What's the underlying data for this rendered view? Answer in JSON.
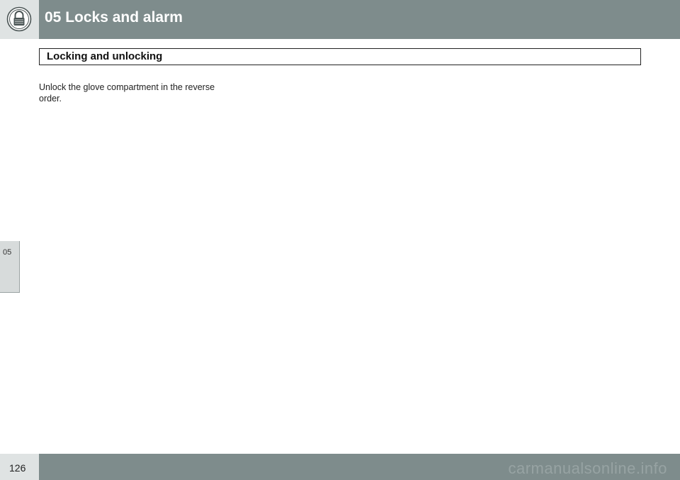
{
  "header": {
    "title": "05 Locks and alarm",
    "icon": "padlock-icon"
  },
  "section": {
    "title": "Locking and unlocking"
  },
  "body": {
    "paragraph": "Unlock the glove compartment in the reverse order."
  },
  "chapter_tab": {
    "label": "05"
  },
  "footer": {
    "page_number": "126",
    "watermark": "carmanualsonline.info"
  },
  "colors": {
    "header_bar": "#7e8c8c",
    "icon_box": "#dfe3e3",
    "tab": "#d7dbdb"
  }
}
